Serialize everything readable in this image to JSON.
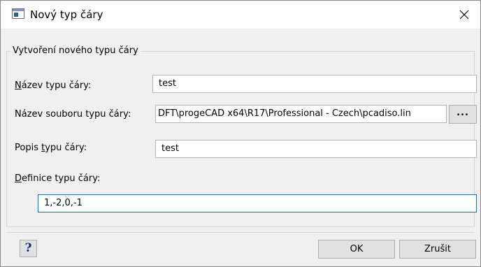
{
  "window": {
    "title": "Nový typ čáry",
    "app_icon": "dialog-window-icon",
    "close_icon": "close-icon"
  },
  "group": {
    "title": "Vytvoření nového typu čáry"
  },
  "form": {
    "name_label_u": "N",
    "name_label_rest": "ázev typu čáry:",
    "name_value": "test",
    "file_label": "Název souboru typu čáry:",
    "file_value": "DFT\\progeCAD x64\\R17\\Professional - Czech\\pcadiso.lin",
    "browse_label": "...",
    "desc_label_pre": "Popis ",
    "desc_label_u": "t",
    "desc_label_rest": "ypu čáry:",
    "desc_value": "test",
    "def_label_u": "D",
    "def_label_rest": "efinice typu čáry:",
    "def_value": "1,-2,0,-1"
  },
  "footer": {
    "help_label": "?",
    "ok_label": "OK",
    "cancel_label": "Zrušit"
  }
}
